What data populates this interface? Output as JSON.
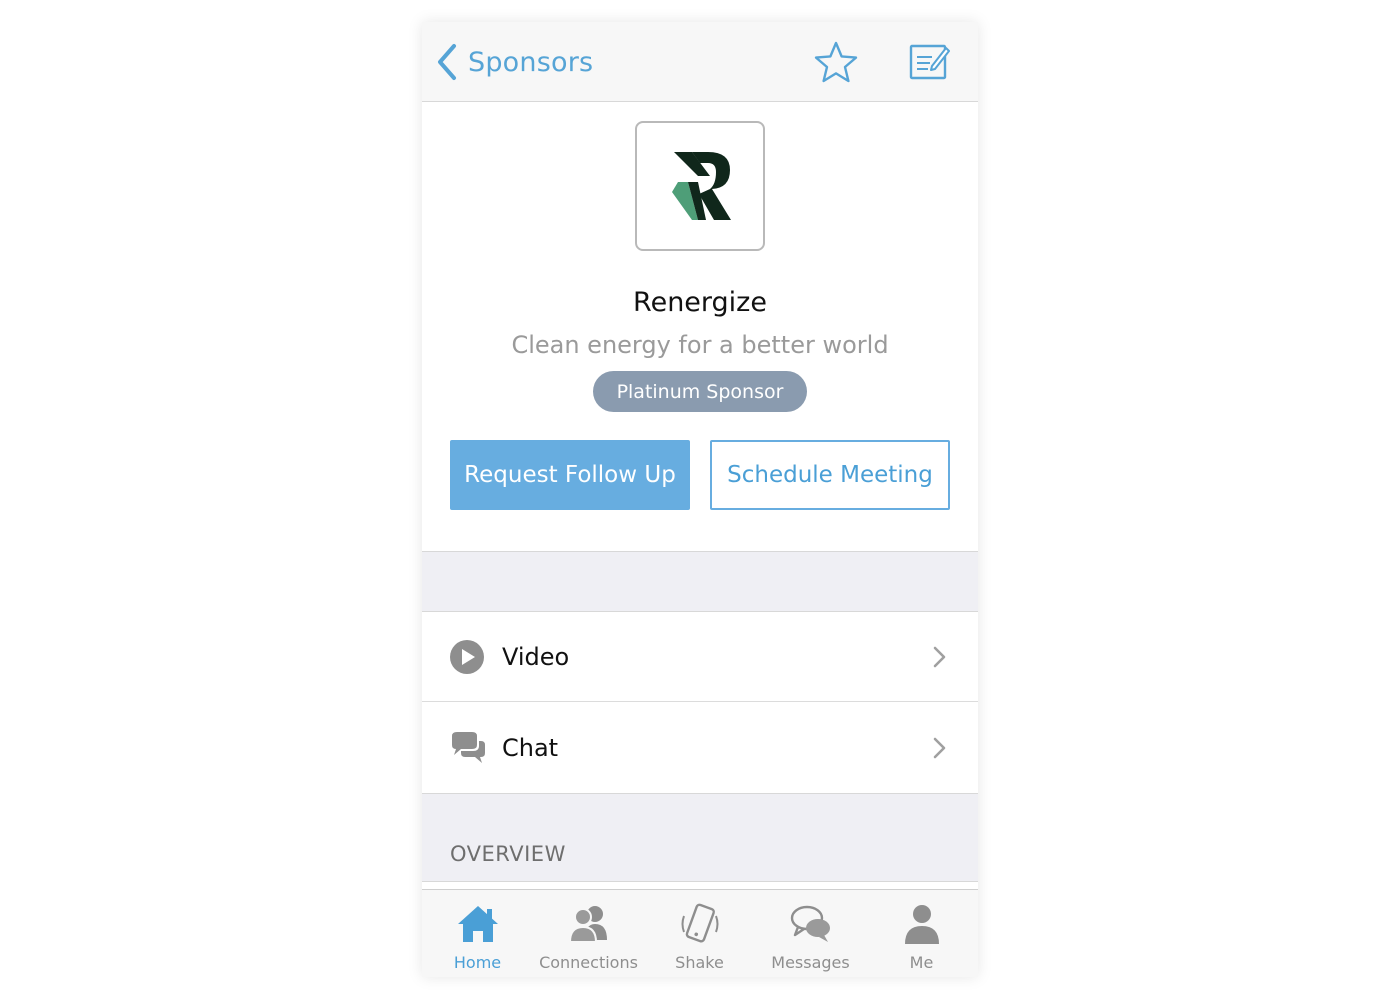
{
  "navbar": {
    "back_label": "Sponsors",
    "icons": [
      "chevron-left-icon",
      "star-icon",
      "notes-icon"
    ],
    "accent_color": "#56a4d6"
  },
  "sponsor": {
    "name": "Renergize",
    "tagline": "Clean energy for a better world",
    "tier": "Platinum Sponsor",
    "tier_color": "#8a9baf"
  },
  "actions": {
    "primary_label": "Request Follow Up",
    "secondary_label": "Schedule Meeting"
  },
  "links": [
    {
      "label": "Video",
      "icon": "play-circle-icon"
    },
    {
      "label": "Chat",
      "icon": "chat-bubbles-icon"
    }
  ],
  "sections": {
    "overview_header": "OVERVIEW"
  },
  "tabbar": {
    "active": "Home",
    "tabs": [
      {
        "label": "Home",
        "icon": "home-icon"
      },
      {
        "label": "Connections",
        "icon": "people-icon"
      },
      {
        "label": "Shake",
        "icon": "phone-shake-icon"
      },
      {
        "label": "Messages",
        "icon": "messages-icon"
      },
      {
        "label": "Me",
        "icon": "person-icon"
      }
    ]
  }
}
